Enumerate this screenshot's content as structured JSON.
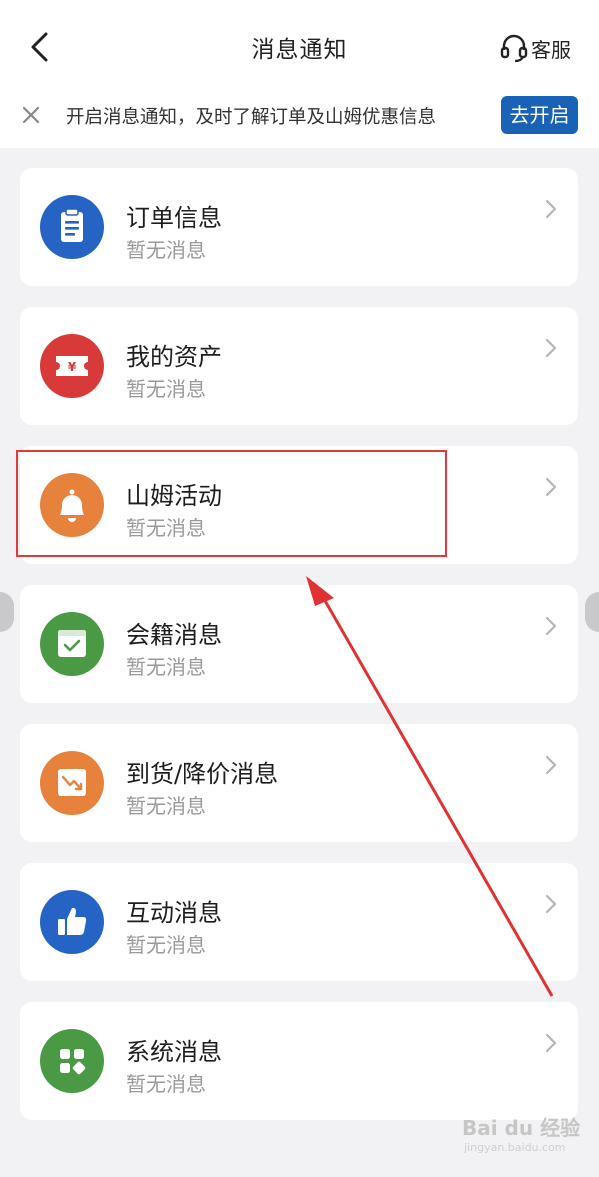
{
  "header": {
    "title": "消息通知",
    "service_label": "客服"
  },
  "notice": {
    "text": "开启消息通知，及时了解订单及山姆优惠信息",
    "button": "去开启"
  },
  "items": [
    {
      "label": "订单信息",
      "status": "暂无消息",
      "icon": "clipboard-icon",
      "color": "#2563c4"
    },
    {
      "label": "我的资产",
      "status": "暂无消息",
      "icon": "coupon-icon",
      "color": "#d83a3a"
    },
    {
      "label": "山姆活动",
      "status": "暂无消息",
      "icon": "bell-icon",
      "color": "#e6823c"
    },
    {
      "label": "会籍消息",
      "status": "暂无消息",
      "icon": "membership-card-icon",
      "color": "#4a9a45"
    },
    {
      "label": "到货/降价消息",
      "status": "暂无消息",
      "icon": "price-drop-icon",
      "color": "#e6823c"
    },
    {
      "label": "互动消息",
      "status": "暂无消息",
      "icon": "thumbs-up-icon",
      "color": "#2563c4"
    },
    {
      "label": "系统消息",
      "status": "暂无消息",
      "icon": "grid-icon",
      "color": "#4a9a45"
    }
  ],
  "watermark": {
    "main": "Bai du 经验",
    "sub": "jingyan.baidu.com"
  }
}
